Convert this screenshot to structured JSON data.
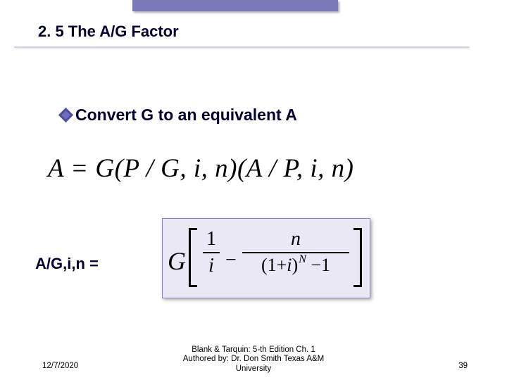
{
  "title": "2. 5 The A/G Factor",
  "bullet_text": "Convert G to an equivalent A",
  "equation1": "A = G(P / G, i, n)(A / P, i, n)",
  "lhs_label": "A/G,i,n  =",
  "eq2": {
    "G": "G",
    "frac1_num": "1",
    "frac1_den": "i",
    "minus": "−",
    "frac2_num": "n",
    "den_open": "(1+",
    "den_i": "i",
    "den_close": ")",
    "den_exp": "N",
    "den_minus": "−",
    "den_one": "1"
  },
  "footer": {
    "date": "12/7/2020",
    "line1": "Blank & Tarquin: 5-th Edition Ch. 1",
    "line2": "Authored by: Dr. Don Smith Texas A&M",
    "line3": "University",
    "page": "39"
  },
  "chart_data": {
    "type": "table",
    "note": "Presentation slide; no quantitative chart series present."
  }
}
